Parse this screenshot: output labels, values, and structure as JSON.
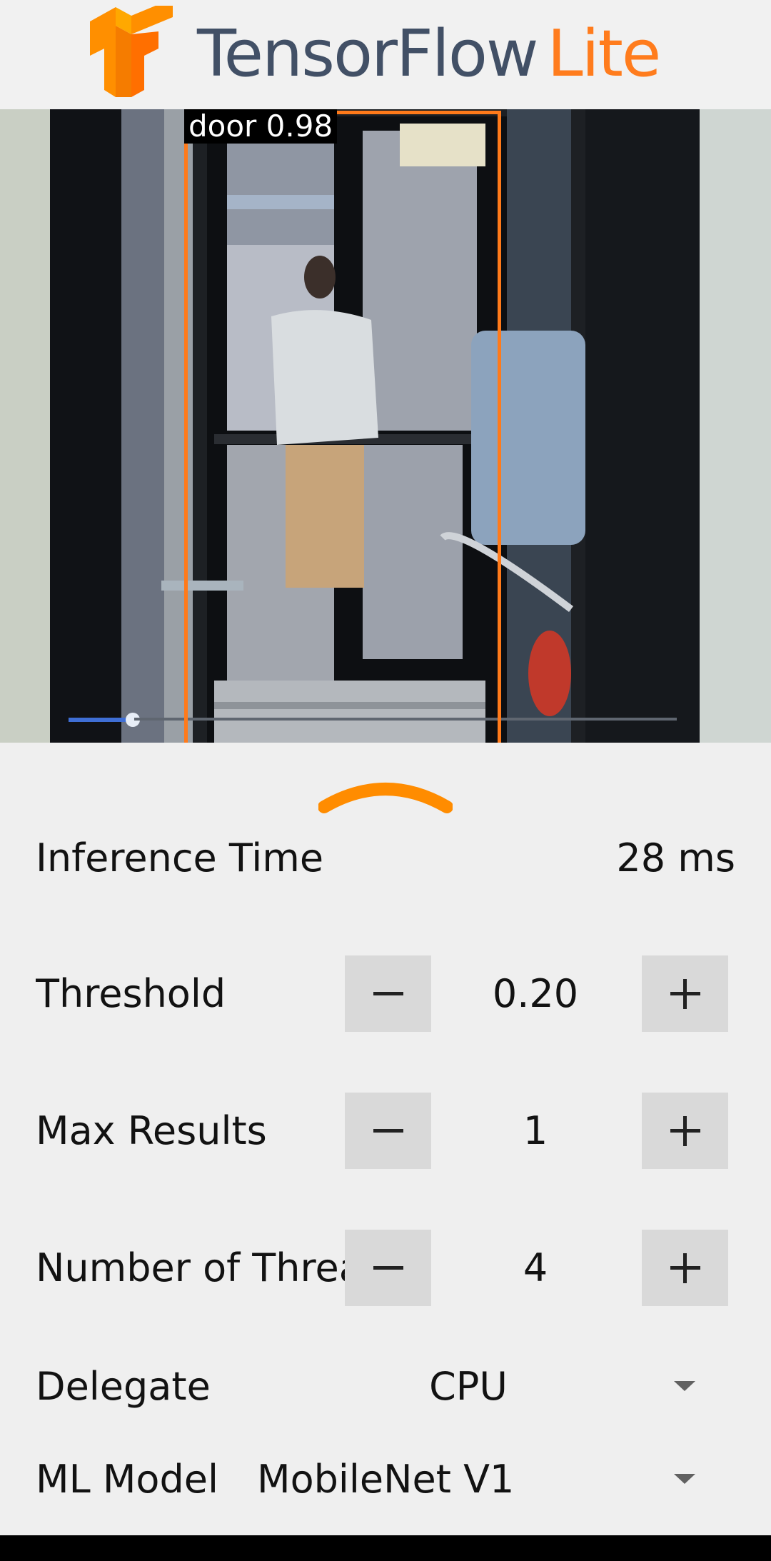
{
  "header": {
    "brand_primary": "TensorFlow",
    "brand_secondary": "Lite",
    "logo_icon": "tensorflow-logo-icon"
  },
  "camera": {
    "detection": {
      "label": "door 0.98"
    },
    "colors": {
      "box": "#ff7a1a"
    }
  },
  "sheet": {
    "handle_icon": "chevron-up-icon",
    "inference": {
      "label": "Inference Time",
      "value": "28 ms"
    },
    "threshold": {
      "label": "Threshold",
      "value": "0.20"
    },
    "max_results": {
      "label": "Max Results",
      "value": "1"
    },
    "threads": {
      "label": "Number of Threads",
      "value": "4"
    },
    "delegate": {
      "label": "Delegate",
      "value": "CPU"
    },
    "model": {
      "label": "ML Model",
      "value": "MobileNet V1"
    }
  },
  "colors": {
    "accent": "#ff7c1d",
    "brand_text": "#425066",
    "button_bg": "#d9d9d9"
  }
}
